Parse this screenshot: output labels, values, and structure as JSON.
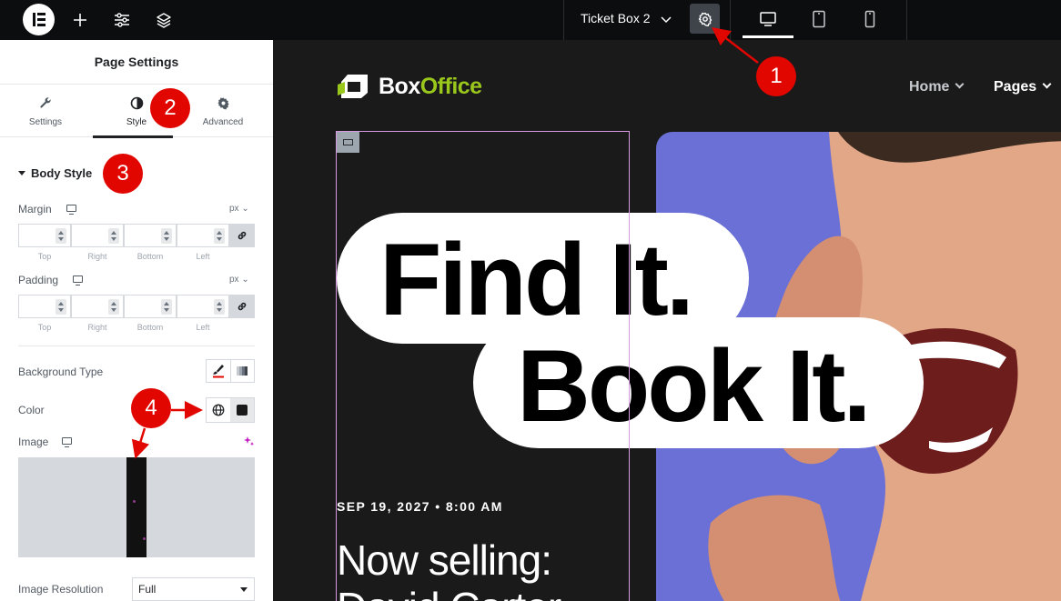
{
  "topbar": {
    "document_title": "Ticket Box 2",
    "tools": [
      "elementor-logo-icon",
      "add-element-icon",
      "site-settings-sliders-icon",
      "structure-layers-icon"
    ],
    "devices": [
      "desktop",
      "tablet",
      "mobile"
    ],
    "active_device": "desktop"
  },
  "panel": {
    "title": "Page Settings",
    "tabs": [
      {
        "label": "Settings",
        "icon": "wrench-icon"
      },
      {
        "label": "Style",
        "icon": "contrast-icon",
        "active": true
      },
      {
        "label": "Advanced",
        "icon": "gear-icon"
      }
    ],
    "section_title": "Body Style",
    "margin": {
      "label": "Margin",
      "unit": "px",
      "sides": [
        "Top",
        "Right",
        "Bottom",
        "Left"
      ]
    },
    "padding": {
      "label": "Padding",
      "unit": "px",
      "sides": [
        "Top",
        "Right",
        "Bottom",
        "Left"
      ]
    },
    "background_type": {
      "label": "Background Type",
      "options": [
        "classic-brush-icon",
        "gradient-icon"
      ],
      "active": "classic-brush-icon"
    },
    "color": {
      "label": "Color",
      "value": "#1a1a1a"
    },
    "image": {
      "label": "Image"
    },
    "image_resolution": {
      "label": "Image Resolution",
      "value": "Full"
    }
  },
  "preview": {
    "logo": {
      "text_main": "Box",
      "text_accent": "Office",
      "accent_color": "#9ac71c"
    },
    "nav": [
      "Home",
      "Pages"
    ],
    "headline_line1": "Find It.",
    "headline_line2": "Book It.",
    "event_date": "SEP 19, 2027 • 8:00 AM",
    "selling_line1": "Now selling:",
    "selling_line2": "David Carter"
  },
  "annotations": [
    "1",
    "2",
    "3",
    "4"
  ],
  "colors": {
    "topbar": "#0c0d0e",
    "panel": "#ffffff",
    "canvas": "#1a1a1a",
    "badge": "#e10600",
    "photo": "#6b70d6",
    "selection": "#d79ae0"
  }
}
